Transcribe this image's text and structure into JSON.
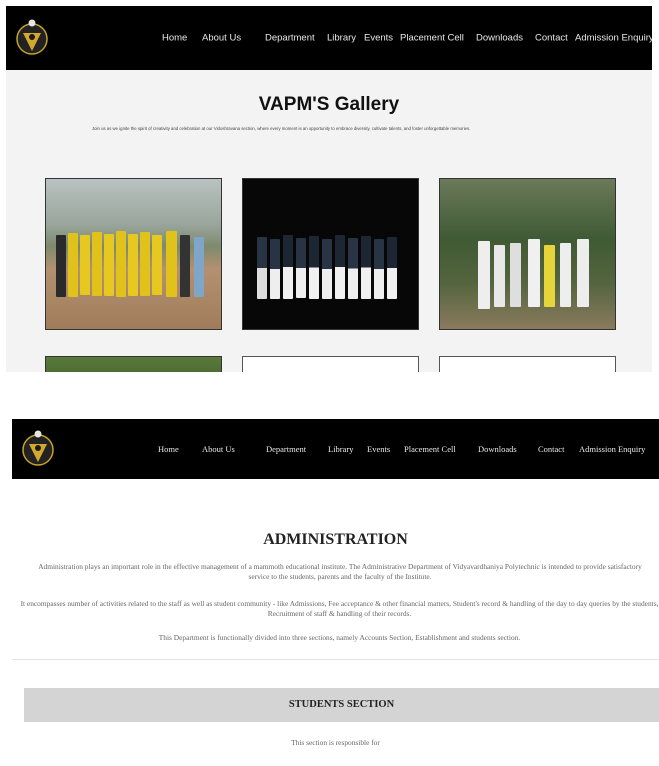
{
  "gallery_page": {
    "nav": [
      "Home",
      "About Us",
      "Department",
      "Library",
      "Events",
      "Placement Cell",
      "Downloads",
      "Contact",
      "Admission Enquiry"
    ],
    "title": "VAPM'S Gallery",
    "description": "Join us as we ignite the spirit of creativity and celebration at our Vidoshravana section, where every moment is an opportunity to embrace diversity, cultivate talents, and foster unforgettable memories.",
    "logo_icon": "college-crest-icon"
  },
  "admin_page": {
    "nav": [
      "Home",
      "About Us",
      "Department",
      "Library",
      "Events",
      "Placement Cell",
      "Downloads",
      "Contact",
      "Admission Enquiry"
    ],
    "title": "ADMINISTRATION",
    "paragraphs": [
      "Administration plays an important role in the effective management of a mammoth educational institute. The Administrative Department of Vidyavardhaniya Polytechnic is intended to provide satisfactory service to the students, parents and the faculty of the Institute.",
      "It encompasses number of activities related to the staff as well as student community - like Admissions, Fee acceptance & other financial matters, Student's record & handling of the day to day queries by the students, Recruitment of staff & handling of their records.",
      "This Department is functionally divided into three sections, namely Accounts Section, Establishment and students section."
    ],
    "section_title": "STUDENTS SECTION",
    "section_text": "This section is responsible for",
    "logo_icon": "college-crest-icon"
  }
}
